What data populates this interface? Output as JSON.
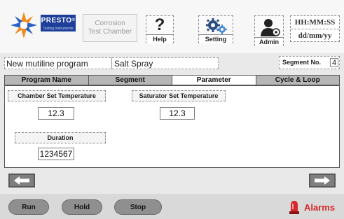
{
  "brand": {
    "name": "PRESTO",
    "registered": "®",
    "tagline": "Testing Instruments"
  },
  "header": {
    "chamber_title_line1": "Corrosion",
    "chamber_title_line2": "Test Chamber",
    "buttons": [
      {
        "id": "help",
        "label": "Help",
        "icon": "question-icon"
      },
      {
        "id": "setting",
        "label": "Setting",
        "icon": "gears-icon"
      },
      {
        "id": "admin",
        "label": "Admin",
        "icon": "admin-user-icon"
      }
    ],
    "clock": {
      "time": "HH:MM:SS",
      "date": "dd/mm/yy"
    }
  },
  "program": {
    "name": "New mutiline program",
    "type": "Salt Spray"
  },
  "segment": {
    "label": "Segment No.",
    "value": "4"
  },
  "tabs": [
    {
      "label": "Program Name"
    },
    {
      "label": "Segment"
    },
    {
      "label": "Parameter"
    },
    {
      "label": "Cycle & Loop"
    }
  ],
  "active_tab": "Parameter",
  "params": {
    "chamber_temp": {
      "label": "Chamber Set Temperature",
      "value": "12.3"
    },
    "saturator_temp": {
      "label": "Saturator Set Temperature",
      "value": "12.3"
    },
    "duration": {
      "label": "Duration",
      "value": "1234567"
    }
  },
  "nav": {
    "prev_icon": "arrow-left-icon",
    "next_icon": "arrow-right-icon"
  },
  "footer": {
    "run_label": "Run",
    "hold_label": "Hold",
    "stop_label": "Stop",
    "alarms_label": "Alarms"
  },
  "colors": {
    "brand_blue": "#1d3f9a",
    "logo_orange": "#f08a1c",
    "alarm_red": "#d62828"
  }
}
